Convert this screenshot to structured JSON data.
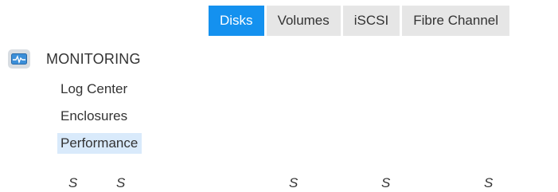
{
  "tabs": [
    {
      "label": "Disks",
      "active": true
    },
    {
      "label": "Volumes",
      "active": false
    },
    {
      "label": "iSCSI",
      "active": false
    },
    {
      "label": "Fibre Channel",
      "active": false
    }
  ],
  "sidebar": {
    "section": {
      "title": "MONITORING",
      "icon": "monitor-pulse-icon"
    },
    "items": [
      {
        "label": "Log Center"
      },
      {
        "label": "Enclosures"
      },
      {
        "label": "Performance",
        "selected": true
      }
    ]
  },
  "bottom_row": [
    "S",
    "S",
    "S",
    "S",
    "S"
  ],
  "colors": {
    "accent": "#1491ef",
    "tab_bg": "#e6e6e6",
    "selected_bg": "#d9eafb"
  }
}
